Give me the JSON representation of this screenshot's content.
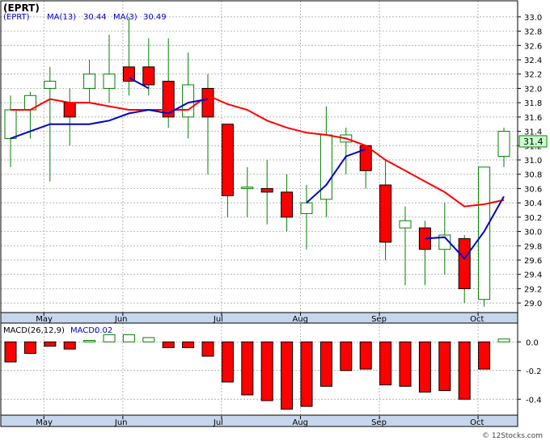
{
  "header": {
    "ticker": "(EPRT)",
    "ma13_label": "MA(13)",
    "ma13_value": "30.44",
    "ma3_label": "MA(3)",
    "ma3_value": "30.49"
  },
  "macd_header": {
    "label": "MACD(26,12,9)",
    "macd_label": "MACD:",
    "macd_value": "0.02"
  },
  "last_price_tag": "31.4",
  "watermark": "© 12Stocks.com",
  "colors": {
    "up": "#ffffff",
    "down": "#ff0000",
    "wick": "#008000",
    "ma13": "#ff0000",
    "ma3": "#0000cc",
    "grid": "#999999",
    "axis_band": "#c6d6ec"
  },
  "chart_data": [
    {
      "type": "candlestick",
      "title": "(EPRT)",
      "ylim": [
        28.9,
        33.1
      ],
      "y_ticks": [
        29.0,
        29.2,
        29.4,
        29.6,
        29.8,
        30.0,
        30.2,
        30.4,
        30.6,
        30.8,
        31.0,
        31.2,
        31.4,
        31.6,
        31.8,
        32.0,
        32.2,
        32.4,
        32.6,
        32.8,
        33.0
      ],
      "x_labels": [
        {
          "label": "May",
          "index": 1.2
        },
        {
          "label": "Jun",
          "index": 5.2
        },
        {
          "label": "Jul",
          "index": 10.2
        },
        {
          "label": "Aug",
          "index": 14.2
        },
        {
          "label": "Sep",
          "index": 18.2
        },
        {
          "label": "Oct",
          "index": 23.2
        }
      ],
      "grid": true,
      "candles": [
        {
          "o": 31.3,
          "h": 31.9,
          "l": 30.9,
          "c": 31.7
        },
        {
          "o": 31.7,
          "h": 31.95,
          "l": 31.3,
          "c": 31.9
        },
        {
          "o": 32.0,
          "h": 32.3,
          "l": 30.7,
          "c": 32.1
        },
        {
          "o": 31.8,
          "h": 32.0,
          "l": 31.2,
          "c": 31.6
        },
        {
          "o": 32.0,
          "h": 32.4,
          "l": 31.8,
          "c": 32.2
        },
        {
          "o": 32.0,
          "h": 32.75,
          "l": 31.8,
          "c": 32.2
        },
        {
          "o": 32.3,
          "h": 33.0,
          "l": 31.9,
          "c": 32.1
        },
        {
          "o": 32.3,
          "h": 32.7,
          "l": 31.9,
          "c": 32.05
        },
        {
          "o": 32.1,
          "h": 32.7,
          "l": 31.45,
          "c": 31.6
        },
        {
          "o": 31.6,
          "h": 32.5,
          "l": 31.3,
          "c": 32.05
        },
        {
          "o": 32.0,
          "h": 32.2,
          "l": 30.8,
          "c": 31.6
        },
        {
          "o": 31.5,
          "h": 31.5,
          "l": 30.2,
          "c": 30.5
        },
        {
          "o": 30.6,
          "h": 30.9,
          "l": 30.2,
          "c": 30.62
        },
        {
          "o": 30.6,
          "h": 31.0,
          "l": 30.1,
          "c": 30.55
        },
        {
          "o": 30.55,
          "h": 30.8,
          "l": 30.0,
          "c": 30.2
        },
        {
          "o": 30.25,
          "h": 30.65,
          "l": 29.75,
          "c": 30.4
        },
        {
          "o": 30.45,
          "h": 31.75,
          "l": 30.2,
          "c": 31.35
        },
        {
          "o": 31.25,
          "h": 31.45,
          "l": 30.8,
          "c": 31.35
        },
        {
          "o": 31.2,
          "h": 31.2,
          "l": 30.6,
          "c": 30.85
        },
        {
          "o": 30.65,
          "h": 31.0,
          "l": 29.6,
          "c": 29.85
        },
        {
          "o": 30.05,
          "h": 30.35,
          "l": 29.25,
          "c": 30.15
        },
        {
          "o": 30.05,
          "h": 30.15,
          "l": 29.25,
          "c": 29.75
        },
        {
          "o": 29.75,
          "h": 30.4,
          "l": 29.4,
          "c": 29.95
        },
        {
          "o": 29.9,
          "h": 29.95,
          "l": 29.0,
          "c": 29.2
        },
        {
          "o": 29.05,
          "h": 30.0,
          "l": 28.95,
          "c": 30.9
        },
        {
          "o": 31.05,
          "h": 31.45,
          "l": 30.9,
          "c": 31.4
        }
      ],
      "series": [
        {
          "name": "MA(13)",
          "values": [
            31.7,
            31.7,
            31.85,
            31.8,
            31.8,
            31.75,
            31.7,
            31.7,
            31.7,
            31.7,
            31.9,
            31.78,
            31.7,
            31.55,
            31.45,
            31.38,
            31.35,
            31.3,
            31.2,
            31.0,
            30.85,
            30.7,
            30.55,
            30.35,
            30.38,
            30.44
          ]
        },
        {
          "name": "MA(3)",
          "values": [
            31.3,
            31.4,
            31.5,
            31.5,
            31.5,
            31.55,
            31.65,
            31.7,
            31.65,
            31.8,
            31.85,
            null,
            null,
            null,
            null,
            null,
            null,
            null,
            null,
            null,
            null,
            null,
            null,
            null,
            null,
            null
          ]
        },
        {
          "name": "MA(3) segment 2",
          "values": [
            null,
            null,
            null,
            null,
            null,
            null,
            null,
            null,
            null,
            null,
            null,
            null,
            null,
            null,
            null,
            30.4,
            30.65,
            31.05,
            31.15,
            null,
            null,
            29.9,
            29.92,
            29.62,
            30.0,
            30.49
          ]
        },
        {
          "name": "MA(3) segment 3",
          "values": [
            null,
            null,
            null,
            null,
            null,
            null,
            32.15,
            32.0,
            null,
            null,
            null,
            null,
            null,
            null,
            null,
            null,
            null,
            null,
            null,
            null,
            null,
            null,
            null,
            null,
            null,
            null
          ]
        }
      ]
    },
    {
      "type": "bar",
      "title": "MACD(26,12,9)",
      "ylim": [
        -0.5,
        0.12
      ],
      "y_ticks": [
        0.0,
        -0.2,
        -0.4
      ],
      "x_labels": [
        {
          "label": "May",
          "index": 1.2
        },
        {
          "label": "Jun",
          "index": 5.2
        },
        {
          "label": "Jul",
          "index": 10.2
        },
        {
          "label": "Aug",
          "index": 14.2
        },
        {
          "label": "Sep",
          "index": 18.2
        },
        {
          "label": "Oct",
          "index": 23.2
        }
      ],
      "grid": true,
      "values": [
        -0.14,
        -0.08,
        -0.03,
        -0.05,
        0.01,
        0.05,
        0.05,
        0.03,
        -0.04,
        -0.04,
        -0.1,
        -0.28,
        -0.37,
        -0.41,
        -0.47,
        -0.45,
        -0.31,
        -0.2,
        -0.19,
        -0.3,
        -0.31,
        -0.35,
        -0.34,
        -0.4,
        -0.19,
        0.02
      ]
    }
  ]
}
